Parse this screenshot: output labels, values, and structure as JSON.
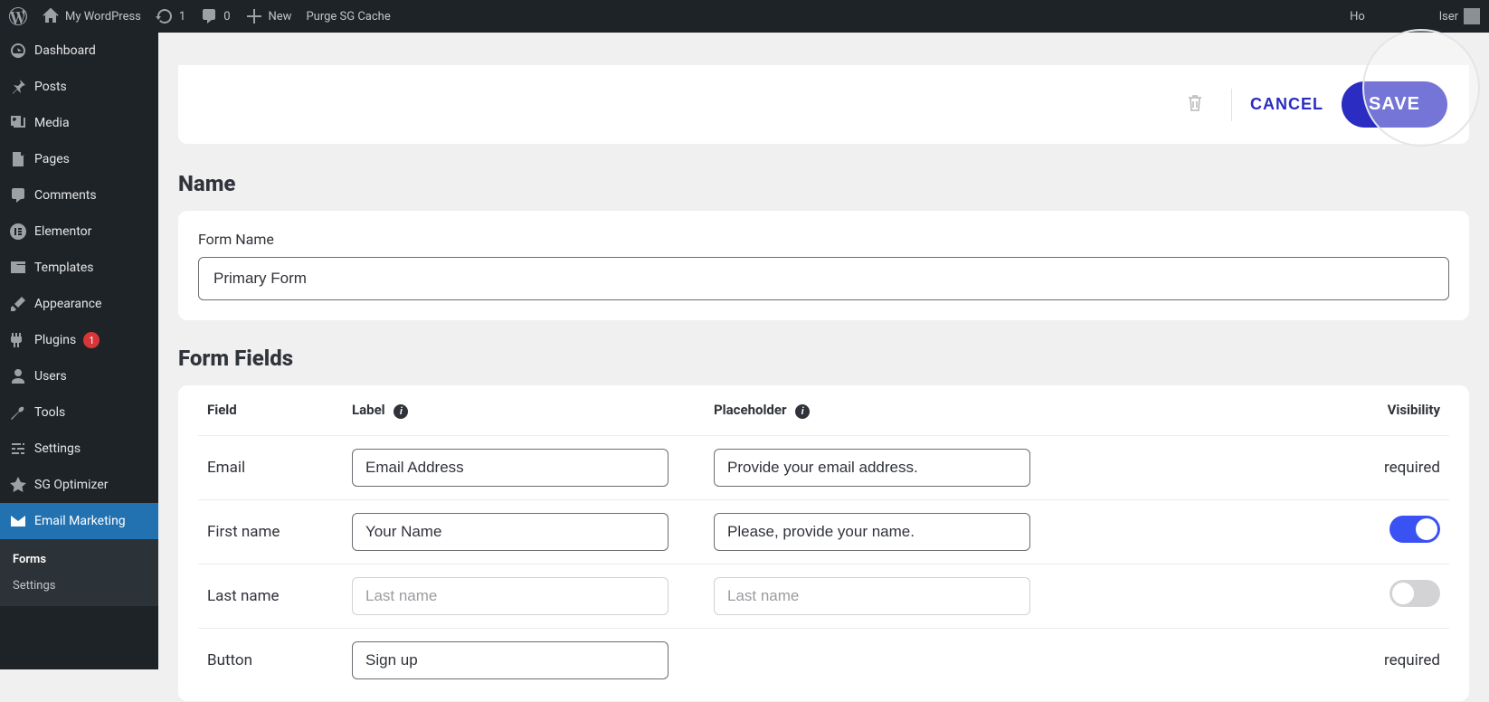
{
  "adminBar": {
    "siteName": "My WordPress",
    "updatesCount": "1",
    "commentsCount": "0",
    "newLabel": "New",
    "purgeLabel": "Purge SG Cache",
    "howdyLeft": "Ho",
    "howdyRight": "lser"
  },
  "sidebar": {
    "items": {
      "dashboard": {
        "label": "Dashboard"
      },
      "posts": {
        "label": "Posts"
      },
      "media": {
        "label": "Media"
      },
      "pages": {
        "label": "Pages"
      },
      "comments": {
        "label": "Comments"
      },
      "elementor": {
        "label": "Elementor"
      },
      "templates": {
        "label": "Templates"
      },
      "appearance": {
        "label": "Appearance"
      },
      "plugins": {
        "label": "Plugins",
        "badge": "1"
      },
      "users": {
        "label": "Users"
      },
      "tools": {
        "label": "Tools"
      },
      "settings": {
        "label": "Settings"
      },
      "sgoptimizer": {
        "label": "SG Optimizer"
      },
      "emailmarketing": {
        "label": "Email Marketing"
      }
    },
    "sub": {
      "forms": "Forms",
      "settings": "Settings"
    }
  },
  "actions": {
    "cancel": "CANCEL",
    "save": "SAVE"
  },
  "sections": {
    "name": {
      "title": "Name",
      "formNameLabel": "Form Name",
      "formNameValue": "Primary Form"
    },
    "fields": {
      "title": "Form Fields",
      "headers": {
        "field": "Field",
        "label": "Label",
        "placeholder": "Placeholder",
        "visibility": "Visibility"
      },
      "rows": {
        "email": {
          "name": "Email",
          "label": "Email Address",
          "placeholder": "Provide your email address.",
          "visibility": "required"
        },
        "firstName": {
          "name": "First name",
          "label": "Your Name",
          "placeholder": "Please, provide your name."
        },
        "lastName": {
          "name": "Last name",
          "labelPlaceholder": "Last name",
          "placeholderPlaceholder": "Last name"
        },
        "button": {
          "name": "Button",
          "label": "Sign up",
          "visibility": "required"
        }
      }
    }
  }
}
